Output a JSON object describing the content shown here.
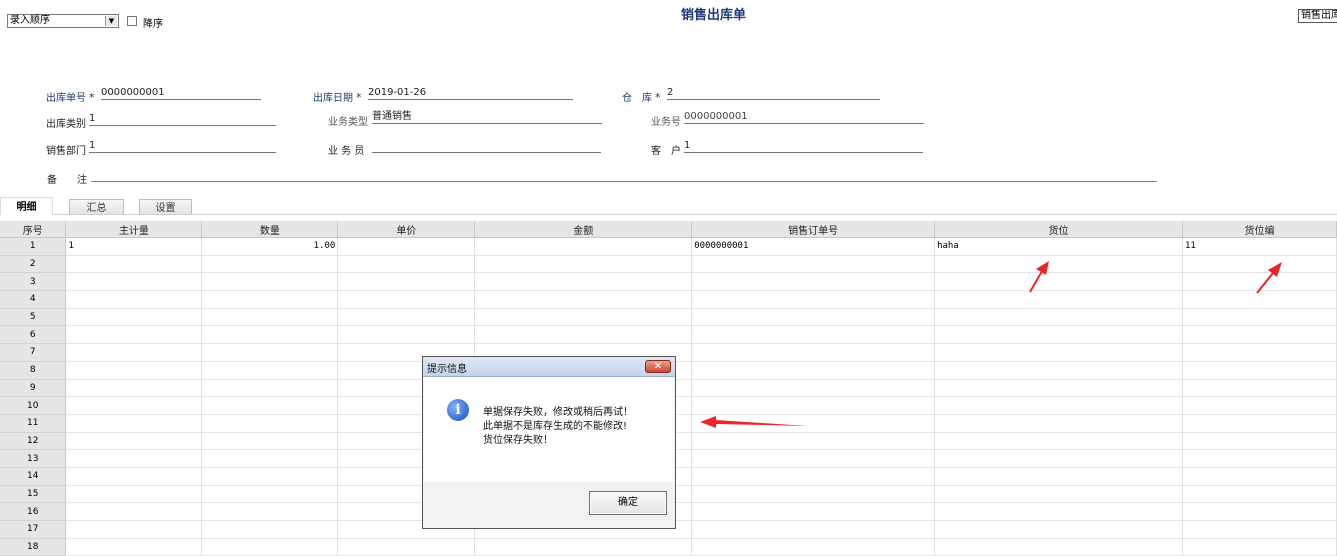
{
  "toolbar": {
    "sort_select_value": "录入顺序",
    "descending_label": "降序",
    "descending_checked": false
  },
  "page": {
    "title": "销售出库单",
    "top_right_text": "销售出库"
  },
  "form": {
    "order_no_label": "出库单号",
    "order_no_value": "0000000001",
    "date_label": "出库日期",
    "date_value": "2019-01-26",
    "warehouse_label": "仓　库",
    "warehouse_value": "2",
    "category_label": "出库类别",
    "category_value": "1",
    "biz_type_label": "业务类型",
    "biz_type_value": "普通销售",
    "biz_no_label": "业务号",
    "biz_no_value": "0000000001",
    "dept_label": "销售部门",
    "dept_value": "1",
    "clerk_label": "业 务 员",
    "clerk_value": "",
    "customer_label": "客　户",
    "customer_value": "1",
    "remark_label": "备　　注",
    "remark_value": "",
    "required_mark": "*"
  },
  "tabs": [
    {
      "label": "明细",
      "active": true
    },
    {
      "label": "汇总",
      "active": false
    },
    {
      "label": "设置",
      "active": false
    }
  ],
  "grid": {
    "columns": [
      "序号",
      "主计量",
      "数量",
      "单价",
      "金额",
      "销售订单号",
      "货位",
      "货位编"
    ],
    "rows": [
      [
        "1",
        "1",
        "1.00",
        "",
        "",
        "0000000001",
        "haha",
        "11"
      ],
      [
        "2",
        "",
        "",
        "",
        "",
        "",
        "",
        ""
      ],
      [
        "3",
        "",
        "",
        "",
        "",
        "",
        "",
        ""
      ],
      [
        "4",
        "",
        "",
        "",
        "",
        "",
        "",
        ""
      ],
      [
        "5",
        "",
        "",
        "",
        "",
        "",
        "",
        ""
      ],
      [
        "6",
        "",
        "",
        "",
        "",
        "",
        "",
        ""
      ],
      [
        "7",
        "",
        "",
        "",
        "",
        "",
        "",
        ""
      ],
      [
        "8",
        "",
        "",
        "",
        "",
        "",
        "",
        ""
      ],
      [
        "9",
        "",
        "",
        "",
        "",
        "",
        "",
        ""
      ],
      [
        "10",
        "",
        "",
        "",
        "",
        "",
        "",
        ""
      ],
      [
        "11",
        "",
        "",
        "",
        "",
        "",
        "",
        ""
      ],
      [
        "12",
        "",
        "",
        "",
        "",
        "",
        "",
        ""
      ],
      [
        "13",
        "",
        "",
        "",
        "",
        "",
        "",
        ""
      ],
      [
        "14",
        "",
        "",
        "",
        "",
        "",
        "",
        ""
      ],
      [
        "15",
        "",
        "",
        "",
        "",
        "",
        "",
        ""
      ],
      [
        "16",
        "",
        "",
        "",
        "",
        "",
        "",
        ""
      ],
      [
        "17",
        "",
        "",
        "",
        "",
        "",
        "",
        ""
      ],
      [
        "18",
        "",
        "",
        "",
        "",
        "",
        "",
        ""
      ]
    ]
  },
  "dialog": {
    "title": "提示信息",
    "close_glyph": "✕",
    "icon": "info-icon",
    "icon_glyph": "i",
    "messages": [
      "单据保存失败，修改或稍后再试！",
      "此单据不是库存生成的不能修改!",
      "货位保存失败！"
    ],
    "ok_label": "确定"
  },
  "colors": {
    "title": "#1f3a7a",
    "annotation_arrow": "#e8262b",
    "dialog_close": "#c8452f"
  }
}
